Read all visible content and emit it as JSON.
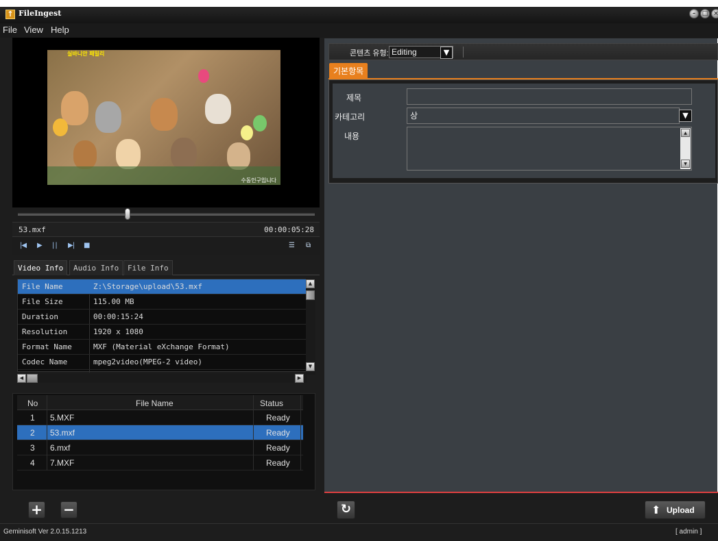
{
  "app": {
    "title": "FileIngest",
    "icon": "upload-app-icon"
  },
  "window_controls": [
    "minimize-icon",
    "maximize-icon",
    "close-icon"
  ],
  "menu": [
    "File",
    "View",
    "Help"
  ],
  "video": {
    "frame_title": "실바니안 패밀리",
    "frame_caption": "수동인구입니다",
    "seek_progress": 0.37,
    "file_name": "53.mxf",
    "timecode": "00:00:05:28",
    "controls": [
      "prev-icon",
      "play-icon",
      "pause-icon",
      "next-icon",
      "stop-icon",
      "playlist-icon",
      "popout-icon"
    ]
  },
  "info_tabs": [
    "Video Info",
    "Audio Info",
    "File Info"
  ],
  "info_table": [
    {
      "key": "File Name",
      "value": "Z:\\Storage\\upload\\53.mxf"
    },
    {
      "key": "File Size",
      "value": "115.00 MB"
    },
    {
      "key": "Duration",
      "value": "00:00:15:24"
    },
    {
      "key": "Resolution",
      "value": "1920 x 1080"
    },
    {
      "key": "Format Name",
      "value": "MXF (Material eXchange Format)"
    },
    {
      "key": "Codec Name",
      "value": "mpeg2video(MPEG-2 video)"
    }
  ],
  "file_list": {
    "headers": {
      "no": "No",
      "name": "File Name",
      "status": "Status"
    },
    "rows": [
      {
        "no": "1",
        "name": "5.MXF",
        "status": "Ready"
      },
      {
        "no": "2",
        "name": "53.mxf",
        "status": "Ready"
      },
      {
        "no": "3",
        "name": "6.mxf",
        "status": "Ready"
      },
      {
        "no": "4",
        "name": "7.MXF",
        "status": "Ready"
      }
    ],
    "selected_index": 1
  },
  "list_buttons": {
    "add": "+",
    "remove": "−"
  },
  "content_type": {
    "label": "콘텐츠 유형:",
    "value": "Editing"
  },
  "form_tab": "기본항목",
  "form": {
    "title_label": "제목",
    "title_value": "",
    "category_label": "카테고리",
    "category_value": "상",
    "content_label": "내용",
    "content_value": ""
  },
  "upload_label": "Upload",
  "status": {
    "version": "Geminisoft Ver 2.0.15.1213",
    "user": "[ admin ]"
  },
  "colors": {
    "selection": "#2d6fbd",
    "accent": "#e8801e",
    "panel": "#3a3f44"
  }
}
